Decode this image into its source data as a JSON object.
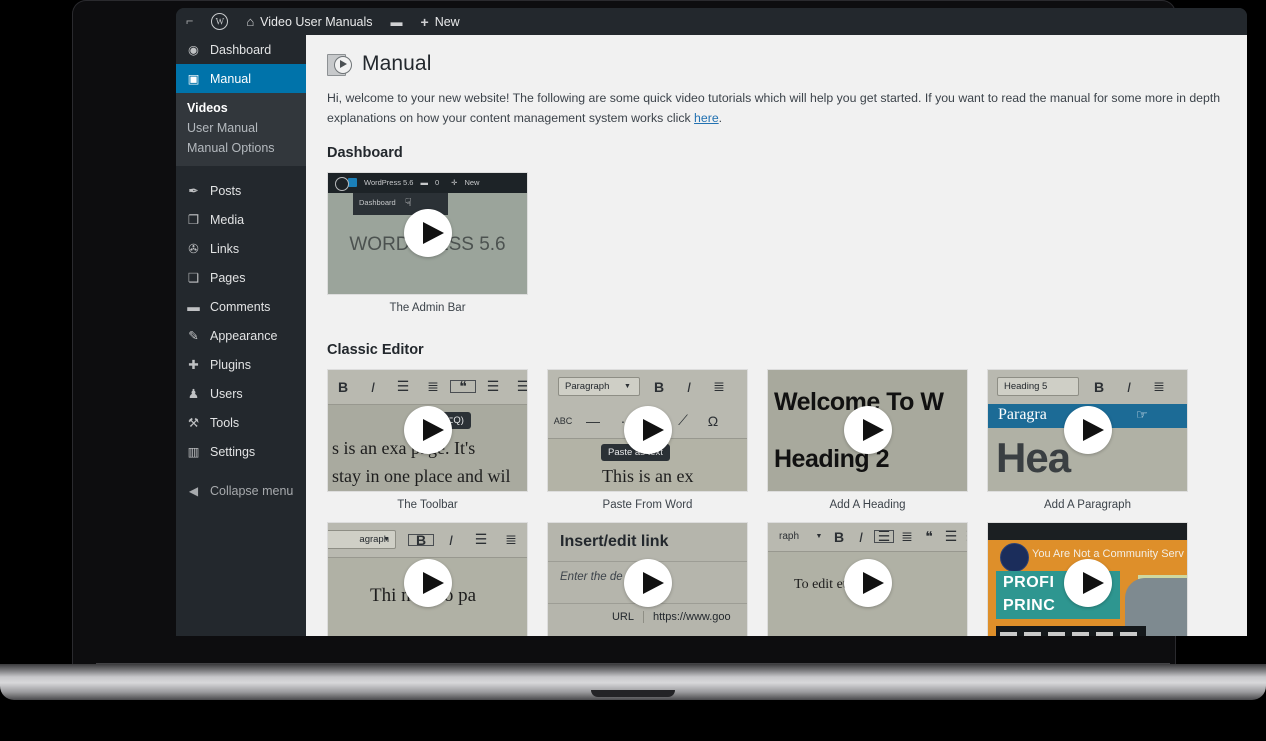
{
  "adminbar": {
    "items": [
      {
        "name": "accessibility-icon",
        "icon": "⌐",
        "label": ""
      },
      {
        "name": "wordpress-logo-icon",
        "icon": "W",
        "label": ""
      },
      {
        "name": "site-name",
        "icon": "⌂",
        "label": "Video User Manuals"
      },
      {
        "name": "comments",
        "icon": "❑",
        "label": ""
      },
      {
        "name": "new-content",
        "icon": "+",
        "label": "New"
      }
    ],
    "site_name": "Video User Manuals",
    "new_label": "New"
  },
  "sidebar": {
    "items": [
      {
        "label": "Dashboard",
        "icon": "◉",
        "current": false
      },
      {
        "label": "Manual",
        "icon": "▣",
        "current": true
      }
    ],
    "submenu": [
      {
        "label": "Videos",
        "current": true
      },
      {
        "label": "User Manual",
        "current": false
      },
      {
        "label": "Manual Options",
        "current": false
      }
    ],
    "items2": [
      {
        "label": "Posts",
        "icon": "✒"
      },
      {
        "label": "Media",
        "icon": "❐"
      },
      {
        "label": "Links",
        "icon": "🔗"
      },
      {
        "label": "Pages",
        "icon": "❏"
      },
      {
        "label": "Comments",
        "icon": "❑"
      },
      {
        "label": "Appearance",
        "icon": "✎"
      },
      {
        "label": "Plugins",
        "icon": "✚"
      },
      {
        "label": "Users",
        "icon": "♟"
      },
      {
        "label": "Tools",
        "icon": "🔧"
      },
      {
        "label": "Settings",
        "icon": "⚙"
      }
    ],
    "collapse": {
      "label": "Collapse menu",
      "icon": "◀"
    },
    "accent_color": "#0073aa",
    "background_color": "#23282d",
    "submenu_background": "#32373c"
  },
  "page": {
    "title": "Manual",
    "intro_before": "Hi, welcome to your new website! The following are some quick video tutorials which will help you get started. If you want to read the manual for some more in depth explanations on how your content management system works click ",
    "intro_link": "here",
    "intro_after": "."
  },
  "sections": [
    {
      "title": "Dashboard",
      "videos": [
        {
          "caption": "The Admin Bar",
          "thumb_type": "dashboard",
          "thumb_text": {
            "adminbar_site": "WordPress 5.6",
            "adminbar_comments": "0",
            "adminbar_new": "New",
            "dropdown": "Dashboard",
            "big_text": "WORDPRESS 5.6"
          }
        }
      ]
    },
    {
      "title": "Classic Editor",
      "videos": [
        {
          "caption": "The Toolbar",
          "thumb_type": "toolbar",
          "thumb_text": {
            "tooltip": "ote (^⌥Q)",
            "line1": "s is an exa    page. It's",
            "line2": "stay in one place and wil"
          }
        },
        {
          "caption": "Paste From Word",
          "thumb_type": "paste-word",
          "thumb_text": {
            "select": "Paragraph",
            "tooltip": "Paste as text",
            "line1": "This is an ex"
          }
        },
        {
          "caption": "Add A Heading",
          "thumb_type": "heading",
          "thumb_text": {
            "line1": "Welcome To W",
            "line2": "Heading 2"
          }
        },
        {
          "caption": "Add A Paragraph",
          "thumb_type": "paragraph",
          "thumb_text": {
            "select": "Heading 5",
            "highlight": "Paragra",
            "big": "Hea"
          }
        },
        {
          "caption": "",
          "thumb_type": "bold",
          "thumb_text": {
            "select": "agraph",
            "line1": "Thi    n hello pa"
          }
        },
        {
          "caption": "",
          "thumb_type": "insert-link",
          "thumb_text": {
            "title": "Insert/edit link",
            "subtitle": "Enter the de        n URL",
            "url_label": "URL",
            "url_value": "https://www.goo"
          }
        },
        {
          "caption": "",
          "thumb_type": "list",
          "thumb_text": {
            "select": "raph",
            "line1": "To edit           etter:"
          }
        },
        {
          "caption": "",
          "thumb_type": "promo",
          "thumb_text": {
            "headline": "You Are Not a Community Serv",
            "teal_line1": "PROFI",
            "teal_line2": "PRINC"
          }
        }
      ]
    }
  ]
}
